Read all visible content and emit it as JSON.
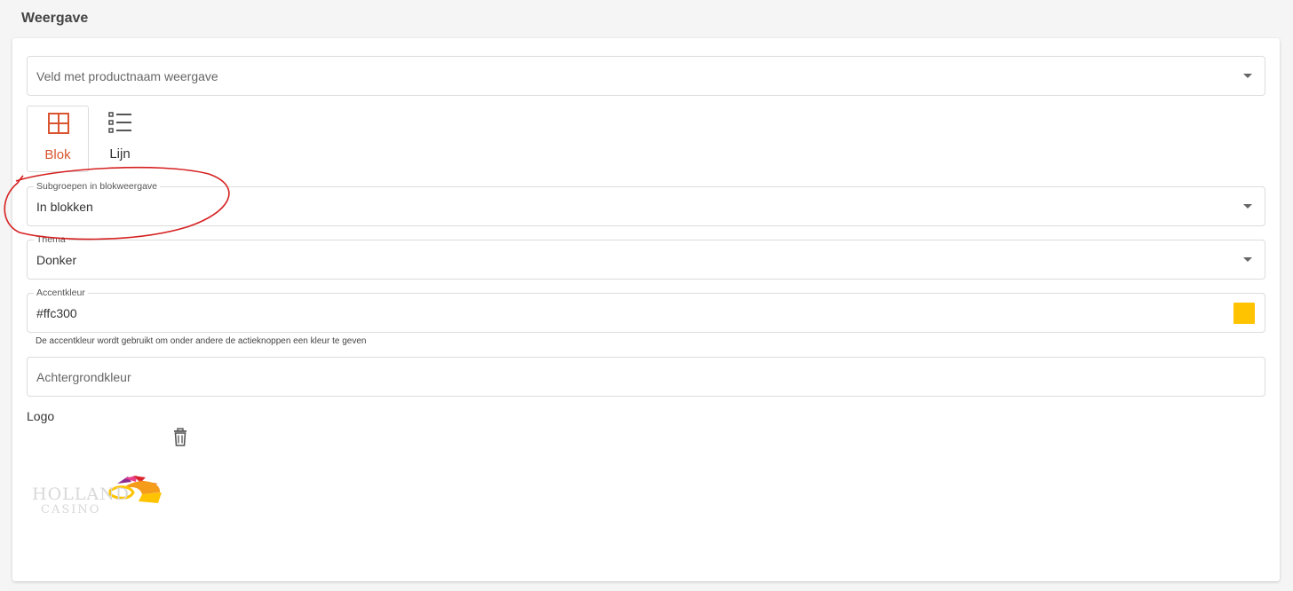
{
  "section": {
    "title": "Weergave"
  },
  "product_name_field": {
    "placeholder": "Veld met productnaam weergave"
  },
  "view_toggle": {
    "options": [
      {
        "label": "Blok",
        "icon": "grid-icon",
        "active": true
      },
      {
        "label": "Lijn",
        "icon": "list-icon",
        "active": false
      }
    ]
  },
  "subgroups_field": {
    "label": "Subgroepen in blokweergave",
    "value": "In blokken"
  },
  "theme_field": {
    "label": "Thema",
    "value": "Donker"
  },
  "accent_field": {
    "label": "Accentkleur",
    "value": "#ffc300",
    "swatch_color": "#ffc300",
    "hint": "De accentkleur wordt gebruikt om onder andere de actieknoppen een kleur te geven"
  },
  "background_field": {
    "placeholder": "Achtergrondkleur"
  },
  "logo": {
    "label": "Logo",
    "delete_icon": "trash-icon",
    "logo_text_line1": "HOLLAND",
    "logo_text_line2": "CASINO"
  },
  "colors": {
    "accent_ui": "#d9552f",
    "annotation": "#d62020"
  }
}
